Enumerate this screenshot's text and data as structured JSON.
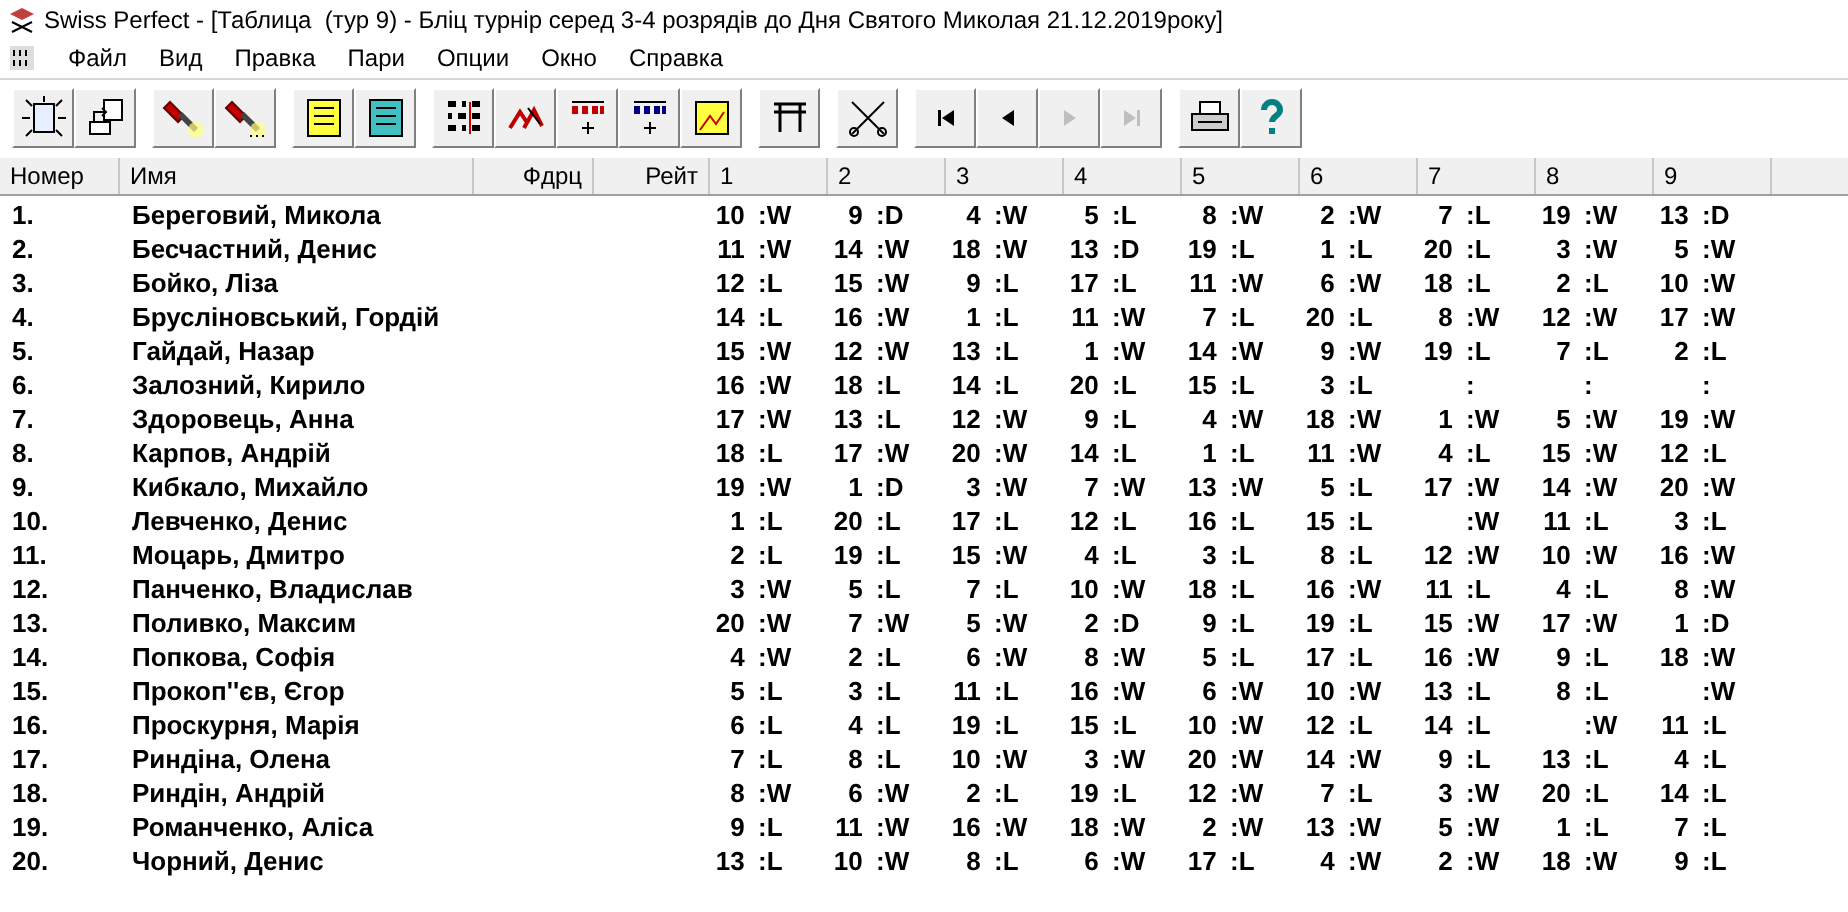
{
  "window": {
    "title": "Swiss Perfect - [Таблица  (тур 9) - Бліц турнір серед 3-4 розрядів до Дня Святого Миколая 21.12.2019року]"
  },
  "menu": [
    "Файл",
    "Вид",
    "Правка",
    "Пари",
    "Опции",
    "Окно",
    "Справка"
  ],
  "toolbar": [
    [
      {
        "kind": "new",
        "disabled": false
      },
      {
        "kind": "export",
        "disabled": false
      }
    ],
    [
      {
        "kind": "torch",
        "disabled": false
      },
      {
        "kind": "torch-more",
        "disabled": false
      }
    ],
    [
      {
        "kind": "list-yellow",
        "disabled": false
      },
      {
        "kind": "list-teal",
        "disabled": false
      }
    ],
    [
      {
        "kind": "binary",
        "disabled": false
      },
      {
        "kind": "pairs",
        "disabled": false
      },
      {
        "kind": "numbers-red",
        "disabled": false
      },
      {
        "kind": "numbers-blue",
        "disabled": false
      },
      {
        "kind": "chart",
        "disabled": false
      }
    ],
    [
      {
        "kind": "table",
        "disabled": false
      }
    ],
    [
      {
        "kind": "cut",
        "disabled": false
      }
    ],
    [
      {
        "kind": "first",
        "disabled": false
      },
      {
        "kind": "prev",
        "disabled": false
      },
      {
        "kind": "next",
        "disabled": true
      },
      {
        "kind": "last",
        "disabled": true
      }
    ],
    [
      {
        "kind": "print",
        "disabled": false
      },
      {
        "kind": "help",
        "disabled": false
      }
    ]
  ],
  "table": {
    "columns": [
      "Номер",
      "Имя",
      "Фдрц",
      "Рейт",
      "1",
      "2",
      "3",
      "4",
      "5",
      "6",
      "7",
      "8",
      "9"
    ],
    "rows": [
      {
        "number": "1.",
        "name": "Береговий, Микола",
        "rounds": [
          "10 :W",
          "9 :D",
          "4 :W",
          "5 :L",
          "8 :W",
          "2 :W",
          "7 :L",
          "19 :W",
          "13 :D"
        ]
      },
      {
        "number": "2.",
        "name": "Бесчастний, Денис",
        "rounds": [
          "11 :W",
          "14 :W",
          "18 :W",
          "13 :D",
          "19 :L",
          "1 :L",
          "20 :L",
          "3 :W",
          "5 :W"
        ]
      },
      {
        "number": "3.",
        "name": "Бойко, Ліза",
        "rounds": [
          "12 :L",
          "15 :W",
          "9 :L",
          "17 :L",
          "11 :W",
          "6 :W",
          "18 :L",
          "2 :L",
          "10 :W"
        ]
      },
      {
        "number": "4.",
        "name": "Брусліновський, Гордій",
        "rounds": [
          "14 :L",
          "16 :W",
          "1 :L",
          "11 :W",
          "7 :L",
          "20 :L",
          "8 :W",
          "12 :W",
          "17 :W"
        ]
      },
      {
        "number": "5.",
        "name": "Гайдай, Назар",
        "rounds": [
          "15 :W",
          "12 :W",
          "13 :L",
          "1 :W",
          "14 :W",
          "9 :W",
          "19 :L",
          "7 :L",
          "2 :L"
        ]
      },
      {
        "number": "6.",
        "name": "Залозний, Кирило",
        "rounds": [
          "16 :W",
          "18 :L",
          "14 :L",
          "20 :L",
          "15 :L",
          "3 :L",
          ":",
          ":",
          ":"
        ]
      },
      {
        "number": "7.",
        "name": "Здоровець, Анна",
        "rounds": [
          "17 :W",
          "13 :L",
          "12 :W",
          "9 :L",
          "4 :W",
          "18 :W",
          "1 :W",
          "5 :W",
          "19 :W"
        ]
      },
      {
        "number": "8.",
        "name": "Карпов, Андрій",
        "rounds": [
          "18 :L",
          "17 :W",
          "20 :W",
          "14 :L",
          "1 :L",
          "11 :W",
          "4 :L",
          "15 :W",
          "12 :L"
        ]
      },
      {
        "number": "9.",
        "name": "Кибкало, Михайло",
        "rounds": [
          "19 :W",
          "1 :D",
          "3 :W",
          "7 :W",
          "13 :W",
          "5 :L",
          "17 :W",
          "14 :W",
          "20 :W"
        ]
      },
      {
        "number": "10.",
        "name": "Левченко, Денис",
        "rounds": [
          "1 :L",
          "20 :L",
          "17 :L",
          "12 :L",
          "16 :L",
          "15 :L",
          ":W",
          "11 :L",
          "3 :L"
        ]
      },
      {
        "number": "11.",
        "name": "Моцарь, Дмитро",
        "rounds": [
          "2 :L",
          "19 :L",
          "15 :W",
          "4 :L",
          "3 :L",
          "8 :L",
          "12 :W",
          "10 :W",
          "16 :W"
        ]
      },
      {
        "number": "12.",
        "name": "Панченко, Владислав",
        "rounds": [
          "3 :W",
          "5 :L",
          "7 :L",
          "10 :W",
          "18 :L",
          "16 :W",
          "11 :L",
          "4 :L",
          "8 :W"
        ]
      },
      {
        "number": "13.",
        "name": "Поливко, Максим",
        "rounds": [
          "20 :W",
          "7 :W",
          "5 :W",
          "2 :D",
          "9 :L",
          "19 :L",
          "15 :W",
          "17 :W",
          "1 :D"
        ]
      },
      {
        "number": "14.",
        "name": "Попкова, Софія",
        "rounds": [
          "4 :W",
          "2 :L",
          "6 :W",
          "8 :W",
          "5 :L",
          "17 :L",
          "16 :W",
          "9 :L",
          "18 :W"
        ]
      },
      {
        "number": "15.",
        "name": "Прокоп''єв, Єгор",
        "rounds": [
          "5 :L",
          "3 :L",
          "11 :L",
          "16 :W",
          "6 :W",
          "10 :W",
          "13 :L",
          "8 :L",
          ":W"
        ]
      },
      {
        "number": "16.",
        "name": "Проскурня, Марія",
        "rounds": [
          "6 :L",
          "4 :L",
          "19 :L",
          "15 :L",
          "10 :W",
          "12 :L",
          "14 :L",
          ":W",
          "11 :L"
        ]
      },
      {
        "number": "17.",
        "name": "Риндіна, Олена",
        "rounds": [
          "7 :L",
          "8 :L",
          "10 :W",
          "3 :W",
          "20 :W",
          "14 :W",
          "9 :L",
          "13 :L",
          "4 :L"
        ]
      },
      {
        "number": "18.",
        "name": "Риндін, Андрій",
        "rounds": [
          "8 :W",
          "6 :W",
          "2 :L",
          "19 :L",
          "12 :W",
          "7 :L",
          "3 :W",
          "20 :L",
          "14 :L"
        ]
      },
      {
        "number": "19.",
        "name": "Романченко, Аліса",
        "rounds": [
          "9 :L",
          "11 :W",
          "16 :W",
          "18 :W",
          "2 :W",
          "13 :W",
          "5 :W",
          "1 :L",
          "7 :L"
        ]
      },
      {
        "number": "20.",
        "name": "Чорний, Денис",
        "rounds": [
          "13 :L",
          "10 :W",
          "8 :L",
          "6 :W",
          "17 :L",
          "4 :W",
          "2 :W",
          "18 :W",
          "9 :L"
        ]
      }
    ]
  }
}
